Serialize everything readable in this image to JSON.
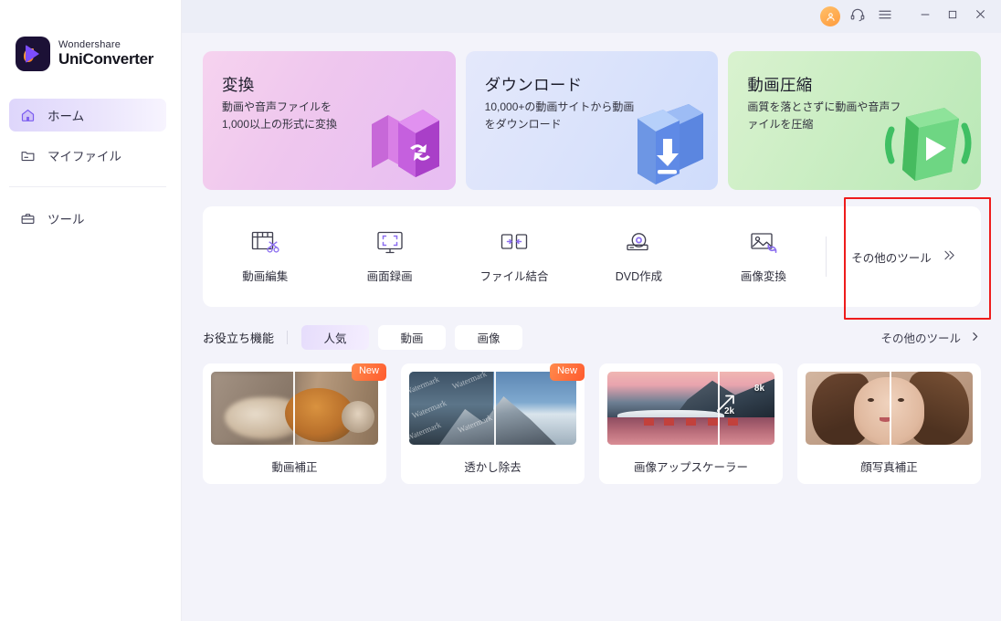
{
  "app": {
    "brand_line1": "Wondershare",
    "brand_line2": "UniConverter",
    "accent": "#7c4dff",
    "highlight_box_color": "#ee1c1c"
  },
  "titlebar": {
    "account_icon": "user-avatar-icon",
    "support_icon": "headset-icon",
    "menu_icon": "hamburger-menu-icon",
    "minimize_icon": "minimize-icon",
    "maximize_icon": "maximize-icon",
    "close_icon": "close-icon"
  },
  "sidebar": {
    "items": [
      {
        "label": "ホーム",
        "icon": "home-icon",
        "active": true
      },
      {
        "label": "マイファイル",
        "icon": "folder-icon",
        "active": false
      },
      {
        "label": "ツール",
        "icon": "toolbox-icon",
        "active": false
      }
    ]
  },
  "hero_cards": [
    {
      "title": "変換",
      "desc": "動画や音声ファイルを1,000以上の形式に変換",
      "icon": "convert-3d-icon",
      "color": "#eec7ef"
    },
    {
      "title": "ダウンロード",
      "desc": "10,000+の動画サイトから動画をダウンロード",
      "icon": "download-3d-icon",
      "color": "#dbe3fb"
    },
    {
      "title": "動画圧縮",
      "desc": "画質を落とさずに動画や音声ファイルを圧縮",
      "icon": "compress-3d-icon",
      "color": "#c9edc2"
    }
  ],
  "tools": {
    "items": [
      {
        "label": "動画編集",
        "icon": "video-edit-icon"
      },
      {
        "label": "画面録画",
        "icon": "screen-record-icon"
      },
      {
        "label": "ファイル結合",
        "icon": "merge-files-icon"
      },
      {
        "label": "DVD作成",
        "icon": "dvd-burn-icon"
      },
      {
        "label": "画像変換",
        "icon": "image-convert-icon"
      }
    ],
    "more_label": "その他のツール",
    "more_icon": "double-chevron-right-icon"
  },
  "filters": {
    "title": "お役立ち機能",
    "chips": [
      {
        "label": "人気",
        "active": true
      },
      {
        "label": "動画",
        "active": false
      },
      {
        "label": "画像",
        "active": false
      }
    ],
    "more_label": "その他のツール",
    "more_icon": "chevron-right-icon"
  },
  "features": [
    {
      "label": "動画補正",
      "badge": "New",
      "thumb": "video-enhance-thumb"
    },
    {
      "label": "透かし除去",
      "badge": "New",
      "thumb": "watermark-remove-thumb",
      "watermark_text": "Watermark"
    },
    {
      "label": "画像アップスケーラー",
      "badge": null,
      "thumb": "image-upscale-thumb",
      "from_label": "2k",
      "to_label": "8k"
    },
    {
      "label": "顔写真補正",
      "badge": null,
      "thumb": "face-retouch-thumb"
    }
  ]
}
